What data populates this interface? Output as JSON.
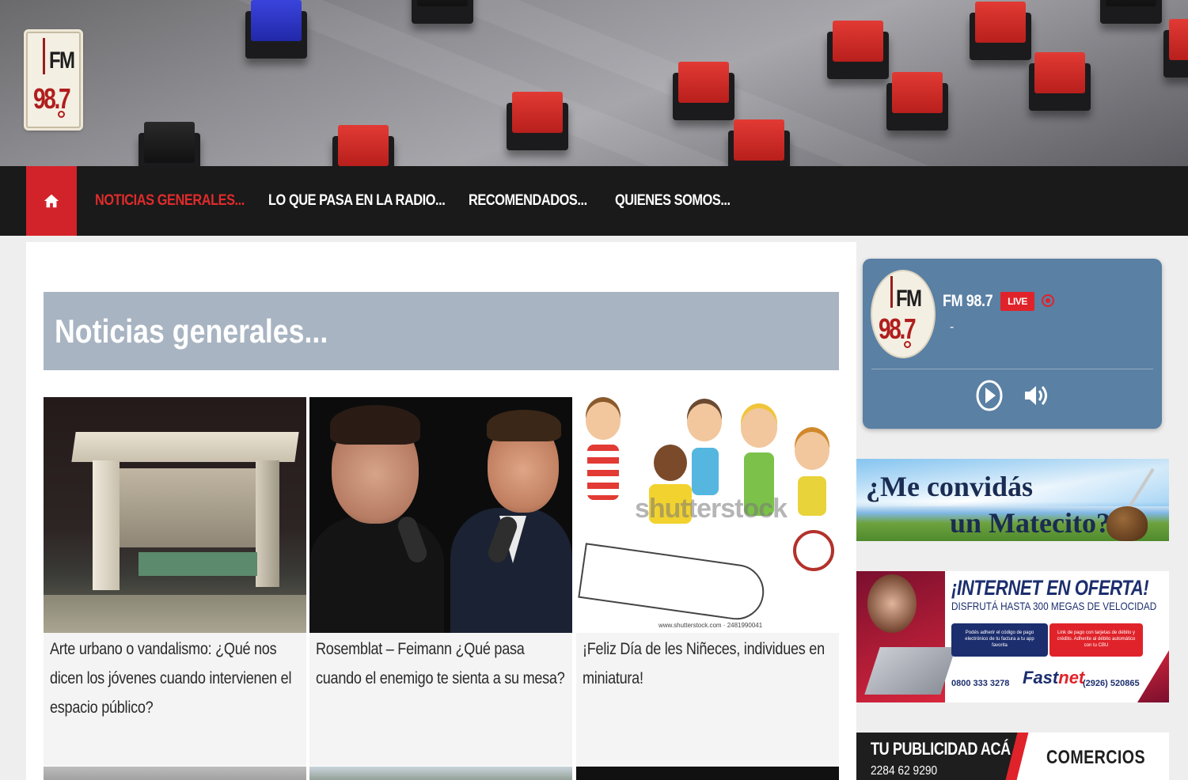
{
  "site": {
    "logo": {
      "fm_text": "FM",
      "freq_text": "98.7"
    }
  },
  "nav": {
    "home_icon": "home-icon",
    "items": [
      {
        "label": "NOTICIAS GENERALES...",
        "active": true
      },
      {
        "label": "LO QUE PASA EN LA RADIO...",
        "active": false
      },
      {
        "label": "RECOMENDADOS...",
        "active": false
      },
      {
        "label": "QUIENES SOMOS...",
        "active": false
      }
    ]
  },
  "main": {
    "section_title": "Noticias generales...",
    "cards": [
      {
        "title": "Arte urbano o vandalismo: ¿Qué nos dicen los jóvenes cuando intervienen el espacio público?"
      },
      {
        "title": "Rosemblat – Feimann ¿Qué pasa cuando el enemigo te sienta a su mesa?"
      },
      {
        "title": "¡Feliz Día de les Niñeces, individues en miniatura!",
        "watermark": "shutterstock",
        "caption": "www.shutterstock.com · 2481990041"
      }
    ]
  },
  "player": {
    "station_name": "FM 98.7",
    "live_label": "LIVE",
    "now_playing": "-",
    "play_icon": "play-icon",
    "volume_icon": "volume-icon"
  },
  "ads": {
    "mate": {
      "line1": "¿Me convidás",
      "line2": "un Matecito?"
    },
    "internet": {
      "headline": "¡INTERNET EN OFERTA!",
      "subline": "DISFRUTÁ HASTA 300 MEGAS DE VELOCIDAD",
      "box1": "Podés adherir el código de pago electrónico de tu factura a tu app favorita",
      "box2": "Link de pago con tarjetas de débito y crédito. Adherite al débito automático con tu CBU",
      "phone1": "0800 333 3278",
      "brand_a": "Fast",
      "brand_b": "net",
      "phone2": "(2926) 520865"
    },
    "publicidad": {
      "title": "TU PUBLICIDAD ACÁ",
      "phone": "2284 62 9290",
      "right": "COMERCIOS"
    }
  },
  "colors": {
    "accent": "#d3232a",
    "nav_bg": "#1a1a1a",
    "player_bg": "#5a80a4",
    "section_bg": "#a8b4c2"
  }
}
